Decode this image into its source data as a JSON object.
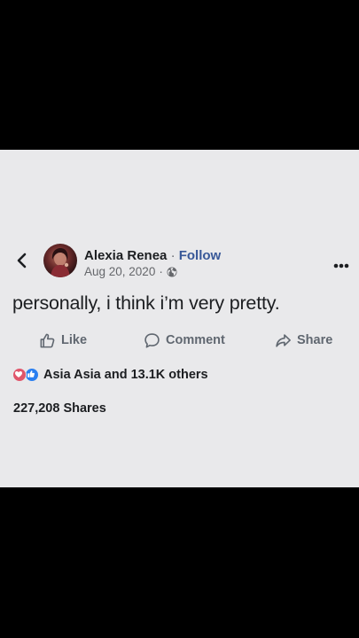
{
  "post": {
    "author_name": "Alexia Renea",
    "separator": "·",
    "follow_label": "Follow",
    "date": "Aug 20, 2020",
    "audience_icon": "globe-icon",
    "text": "personally, i think i’m very pretty."
  },
  "actions": {
    "like_label": "Like",
    "comment_label": "Comment",
    "share_label": "Share"
  },
  "engagement": {
    "reaction_icons": [
      "love-icon",
      "like-icon"
    ],
    "reactions_summary": "Asia Asia and 13.1K others",
    "shares": "227,208 Shares"
  },
  "colors": {
    "card_background": "#e9e9eb",
    "follow_blue": "#385898",
    "love_red": "#e0566b",
    "like_blue": "#2a7ff0"
  }
}
